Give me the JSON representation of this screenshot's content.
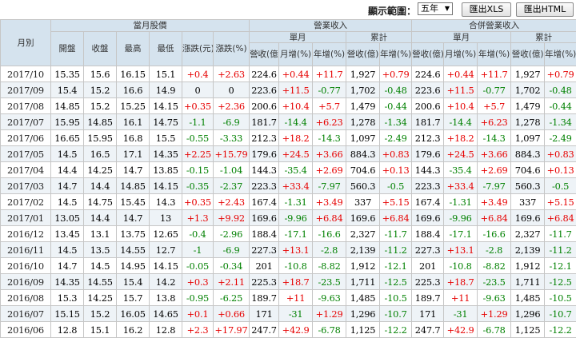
{
  "toolbar": {
    "range_label": "顯示範圍：",
    "range_value": "五年",
    "xls_button": "匯出XLS",
    "html_button": "匯出HTML"
  },
  "headers": {
    "month": "月別",
    "price_group": "當月股價",
    "revenue_group": "營業收入",
    "consolidated_group": "合併營業收入",
    "single_month": "單月",
    "cumulative": "累計",
    "open": "開盤",
    "close": "收盤",
    "high": "最高",
    "low": "最低",
    "change_yuan": "漲跌(元)",
    "change_pct": "漲跌(%)",
    "revenue": "營收(億)",
    "mom": "月增(%)",
    "yoy": "年增(%)"
  },
  "colors": {
    "header_bg": "#d5e3ee",
    "positive": "#e60000",
    "negative": "#008000"
  },
  "rows": [
    [
      "2017/10",
      "15.35",
      "15.6",
      "16.15",
      "15.1",
      "+0.4",
      "+2.63",
      "224.6",
      "+0.44",
      "+11.7",
      "1,927",
      "+0.79",
      "224.6",
      "+0.44",
      "+11.7",
      "1,927",
      "+0.79"
    ],
    [
      "2017/09",
      "15.4",
      "15.2",
      "16.6",
      "14.9",
      "0",
      "0",
      "223.6",
      "+11.5",
      "-0.77",
      "1,702",
      "-0.48",
      "223.6",
      "+11.5",
      "-0.77",
      "1,702",
      "-0.48"
    ],
    [
      "2017/08",
      "14.85",
      "15.2",
      "15.25",
      "14.15",
      "+0.35",
      "+2.36",
      "200.6",
      "+10.4",
      "+5.7",
      "1,479",
      "-0.44",
      "200.6",
      "+10.4",
      "+5.7",
      "1,479",
      "-0.44"
    ],
    [
      "2017/07",
      "15.95",
      "14.85",
      "16.1",
      "14.75",
      "-1.1",
      "-6.9",
      "181.7",
      "-14.4",
      "+6.23",
      "1,278",
      "-1.34",
      "181.7",
      "-14.4",
      "+6.23",
      "1,278",
      "-1.34"
    ],
    [
      "2017/06",
      "16.65",
      "15.95",
      "16.8",
      "15.5",
      "-0.55",
      "-3.33",
      "212.3",
      "+18.2",
      "-14.3",
      "1,097",
      "-2.49",
      "212.3",
      "+18.2",
      "-14.3",
      "1,097",
      "-2.49"
    ],
    [
      "2017/05",
      "14.5",
      "16.5",
      "17.1",
      "14.35",
      "+2.25",
      "+15.79",
      "179.6",
      "+24.5",
      "+3.66",
      "884.3",
      "+0.83",
      "179.6",
      "+24.5",
      "+3.66",
      "884.3",
      "+0.83"
    ],
    [
      "2017/04",
      "14.4",
      "14.25",
      "14.7",
      "13.85",
      "-0.15",
      "-1.04",
      "144.3",
      "-35.4",
      "+2.69",
      "704.6",
      "+0.13",
      "144.3",
      "-35.4",
      "+2.69",
      "704.6",
      "+0.13"
    ],
    [
      "2017/03",
      "14.7",
      "14.4",
      "14.85",
      "14.15",
      "-0.35",
      "-2.37",
      "223.3",
      "+33.4",
      "-7.97",
      "560.3",
      "-0.5",
      "223.3",
      "+33.4",
      "-7.97",
      "560.3",
      "-0.5"
    ],
    [
      "2017/02",
      "14.5",
      "14.75",
      "15.45",
      "14.3",
      "+0.35",
      "+2.43",
      "167.4",
      "-1.31",
      "+3.49",
      "337",
      "+5.15",
      "167.4",
      "-1.31",
      "+3.49",
      "337",
      "+5.15"
    ],
    [
      "2017/01",
      "13.05",
      "14.4",
      "14.7",
      "13",
      "+1.3",
      "+9.92",
      "169.6",
      "-9.96",
      "+6.84",
      "169.6",
      "+6.84",
      "169.6",
      "-9.96",
      "+6.84",
      "169.6",
      "+6.84"
    ],
    [
      "2016/12",
      "13.45",
      "13.1",
      "13.75",
      "12.65",
      "-0.4",
      "-2.96",
      "188.4",
      "-17.1",
      "-16.6",
      "2,327",
      "-11.7",
      "188.4",
      "-17.1",
      "-16.6",
      "2,327",
      "-11.7"
    ],
    [
      "2016/11",
      "14.5",
      "13.5",
      "14.55",
      "12.7",
      "-1",
      "-6.9",
      "227.3",
      "+13.1",
      "-2.8",
      "2,139",
      "-11.2",
      "227.3",
      "+13.1",
      "-2.8",
      "2,139",
      "-11.2"
    ],
    [
      "2016/10",
      "14.7",
      "14.5",
      "14.95",
      "14.15",
      "-0.05",
      "-0.34",
      "201",
      "-10.8",
      "-8.82",
      "1,912",
      "-12.1",
      "201",
      "-10.8",
      "-8.82",
      "1,912",
      "-12.1"
    ],
    [
      "2016/09",
      "14.35",
      "14.55",
      "15.4",
      "14.2",
      "+0.3",
      "+2.11",
      "225.3",
      "+18.7",
      "-23.5",
      "1,711",
      "-12.5",
      "225.3",
      "+18.7",
      "-23.5",
      "1,711",
      "-12.5"
    ],
    [
      "2016/08",
      "15.3",
      "14.25",
      "15.7",
      "13.8",
      "-0.95",
      "-6.25",
      "189.7",
      "+11",
      "-9.63",
      "1,485",
      "-10.5",
      "189.7",
      "+11",
      "-9.63",
      "1,485",
      "-10.5"
    ],
    [
      "2016/07",
      "15.15",
      "15.2",
      "16.05",
      "14.65",
      "+0.1",
      "+0.66",
      "171",
      "-31",
      "+1.29",
      "1,296",
      "-10.7",
      "171",
      "-31",
      "+1.29",
      "1,296",
      "-10.7"
    ],
    [
      "2016/06",
      "12.8",
      "15.1",
      "16.2",
      "12.8",
      "+2.3",
      "+17.97",
      "247.7",
      "+42.9",
      "-6.78",
      "1,125",
      "-12.2",
      "247.7",
      "+42.9",
      "-6.78",
      "1,125",
      "-12.2"
    ]
  ]
}
